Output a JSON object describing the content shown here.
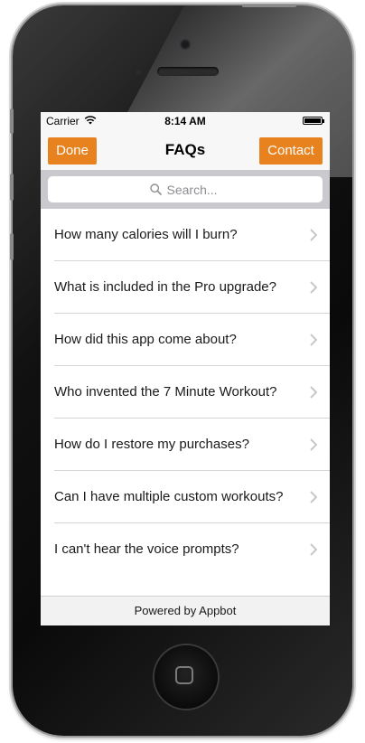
{
  "status_bar": {
    "carrier": "Carrier",
    "time": "8:14 AM"
  },
  "nav": {
    "title": "FAQs",
    "left_button": "Done",
    "right_button": "Contact"
  },
  "search": {
    "placeholder": "Search..."
  },
  "faqs": [
    "How many calories will I burn?",
    "What is included in the Pro upgrade?",
    "How did this app come about?",
    "Who invented the 7 Minute Workout?",
    "How do I restore my purchases?",
    "Can I have multiple custom workouts?",
    "I can't hear the voice prompts?"
  ],
  "footer": {
    "text": "Powered by Appbot"
  },
  "colors": {
    "accent": "#e8821e",
    "nav_background": "#f7f7f7",
    "search_background": "#c9c9ce"
  }
}
